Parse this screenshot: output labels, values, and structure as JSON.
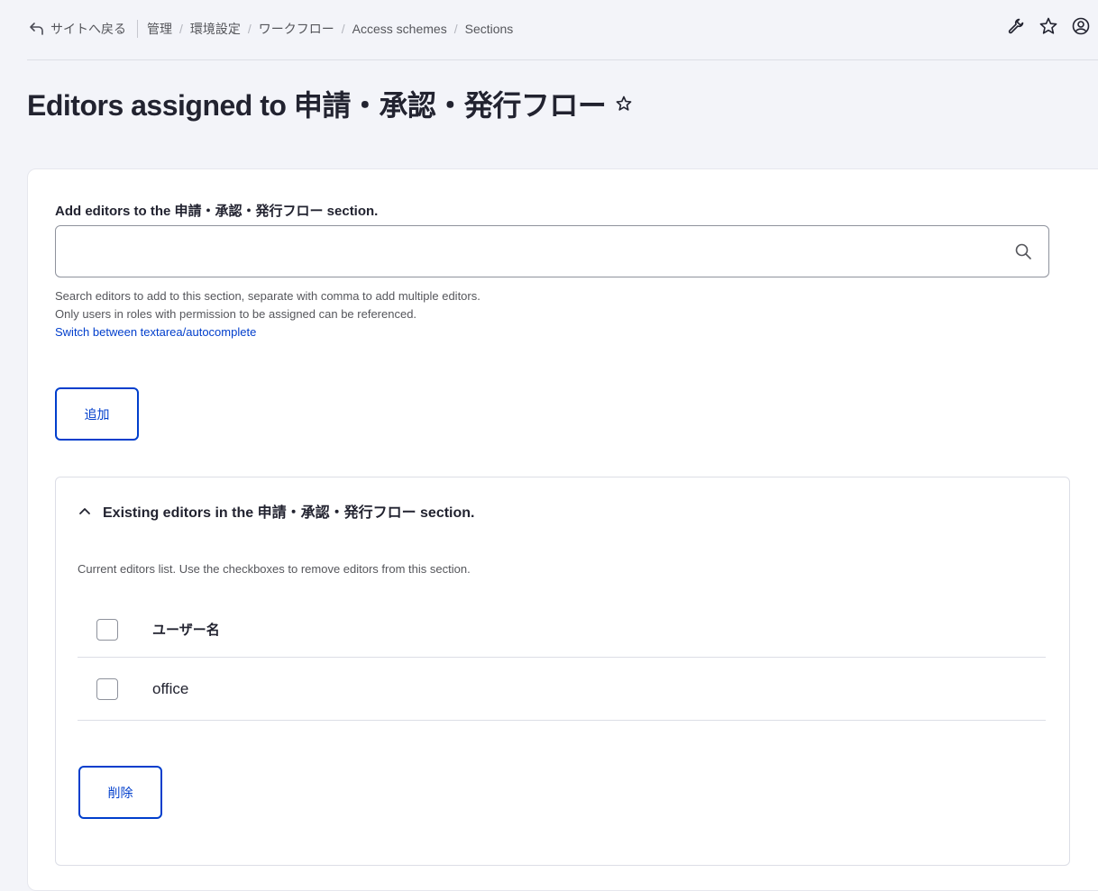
{
  "breadcrumb": {
    "back_label": "サイトへ戻る",
    "items": [
      "管理",
      "環境設定",
      "ワークフロー",
      "Access schemes",
      "Sections"
    ]
  },
  "page": {
    "title": "Editors assigned to 申請・承認・発行フロー"
  },
  "form": {
    "label": "Add editors to the 申請・承認・発行フロー section.",
    "search_value": "",
    "description_line1": "Search editors to add to this section, separate with comma to add multiple editors.",
    "description_line2": "Only users in roles with permission to be assigned can be referenced.",
    "toggle_link": "Switch between textarea/autocomplete",
    "add_button": "追加"
  },
  "existing": {
    "summary": "Existing editors in the 申請・承認・発行フロー section.",
    "description": "Current editors list. Use the checkboxes to remove editors from this section.",
    "table_header": "ユーザー名",
    "rows": [
      {
        "username": "office"
      }
    ],
    "remove_button": "削除"
  },
  "colors": {
    "accent": "#003ecc",
    "background": "#f3f4f9",
    "text": "#222330"
  }
}
